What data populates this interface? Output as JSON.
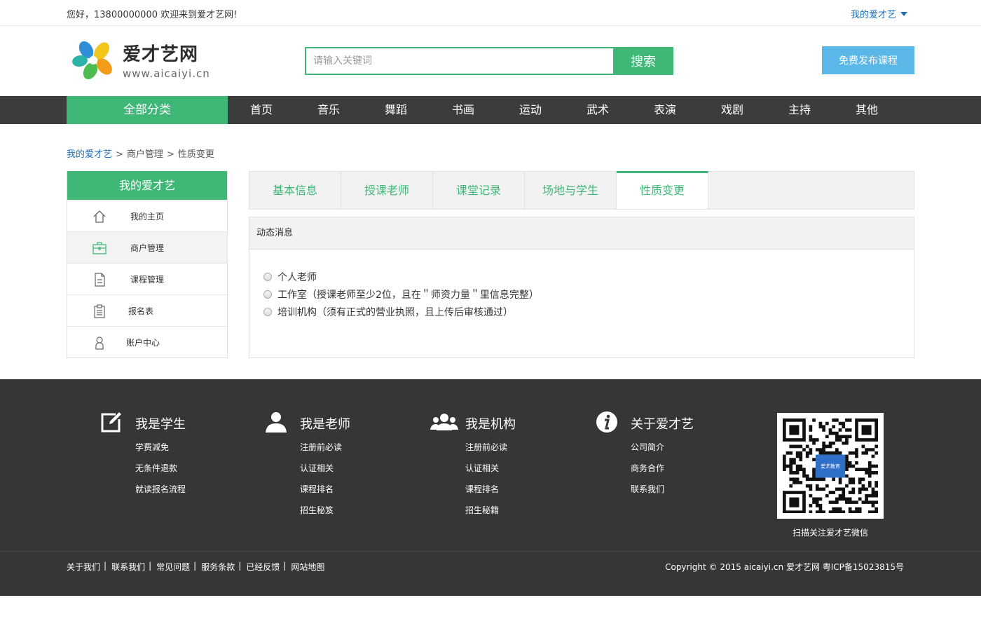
{
  "topbar": {
    "welcome": "您好，13800000000 欢迎来到爱才艺网!",
    "my_account": "我的爱才艺"
  },
  "header": {
    "logo_cn": "爱才艺网",
    "logo_en": "www.aicaiyi.cn",
    "search_placeholder": "请输入关键词",
    "search_button": "搜索",
    "publish_button": "免费发布课程"
  },
  "nav": {
    "all_categories": "全部分类",
    "items": [
      "首页",
      "音乐",
      "舞蹈",
      "书画",
      "运动",
      "武术",
      "表演",
      "戏剧",
      "主持",
      "其他"
    ]
  },
  "breadcrumb": {
    "home": "我的爱才艺",
    "level2": "商户管理",
    "current": "性质变更",
    "separator": ">"
  },
  "sidebar": {
    "title": "我的爱才艺",
    "items": [
      {
        "label": "我的主页",
        "icon": "home-icon"
      },
      {
        "label": "商户管理",
        "icon": "briefcase-icon"
      },
      {
        "label": "课程管理",
        "icon": "document-icon"
      },
      {
        "label": "报名表",
        "icon": "clipboard-icon"
      },
      {
        "label": "账户中心",
        "icon": "user-icon"
      }
    ]
  },
  "tabs": [
    "基本信息",
    "授课老师",
    "课堂记录",
    "场地与学生",
    "性质变更"
  ],
  "panel": {
    "title": "动态消息",
    "options": [
      "个人老师",
      "工作室（授课老师至少2位，且在＂师资力量＂里信息完整）",
      "培训机构（须有正式的营业执照，且上传后审核通过）"
    ]
  },
  "footer": {
    "columns": [
      {
        "title": "我是学生",
        "icon": "edit-icon",
        "links": [
          "学费减免",
          "无条件退款",
          "就读报名流程"
        ]
      },
      {
        "title": "我是老师",
        "icon": "person-icon",
        "links": [
          "注册前必读",
          "认证相关",
          "课程排名",
          "招生秘笈"
        ]
      },
      {
        "title": "我是机构",
        "icon": "group-icon",
        "links": [
          "注册前必读",
          "认证相关",
          "课程排名",
          "招生秘籍"
        ]
      },
      {
        "title": "关于爱才艺",
        "icon": "info-icon",
        "links": [
          "公司简介",
          "商务合作",
          "联系我们"
        ]
      }
    ],
    "qr_label": "爱艺教育",
    "qr_caption": "扫描关注爱才艺微信",
    "bottom_links": [
      "关于我们",
      "联系我们",
      "常见问题",
      "服务条款",
      "已经反馈",
      "网站地图"
    ],
    "copyright": "Copyright © 2015 aicaiyi.cn 爱才艺网 粤ICP备15023815号"
  },
  "colors": {
    "brand_green": "#3fb877",
    "nav_dark": "#3b3c3e",
    "footer_dark": "#363636",
    "publish_blue": "#5bb7e8",
    "link_blue": "#1e6fb8"
  }
}
